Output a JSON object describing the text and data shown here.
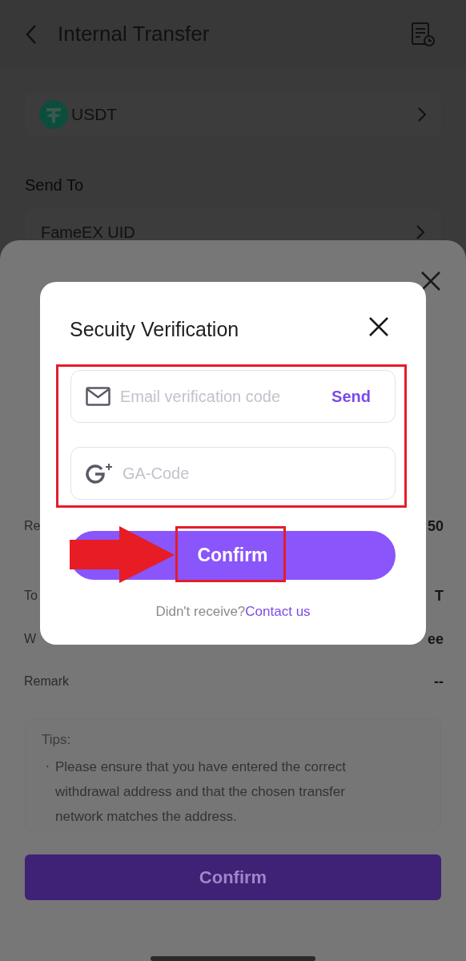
{
  "header": {
    "title": "Internal Transfer"
  },
  "coin": {
    "symbol": "USDT"
  },
  "send_to": {
    "label": "Send To",
    "value": "FameEX UID"
  },
  "sheet": {
    "rows": [
      {
        "label": "Re",
        "value": "50"
      },
      {
        "label": "To",
        "value": "T"
      },
      {
        "label": "W",
        "value": "ee"
      },
      {
        "label": "Remark",
        "value": "--"
      }
    ],
    "tips": {
      "title": "Tips:",
      "items": [
        {
          "bullet": "・",
          "text": "Please ensure that you have entered the correct withdrawal address and that the chosen transfer network matches the address."
        }
      ]
    },
    "button": "Confirm"
  },
  "dialog": {
    "title": "Secuity Verification",
    "fields": [
      {
        "kind": "email",
        "placeholder": "Email verification code",
        "action": "Send"
      },
      {
        "kind": "ga",
        "placeholder": "GA-Code"
      }
    ],
    "button": "Confirm",
    "footer": {
      "text": "Didn't receive?",
      "link": "Contact us"
    }
  }
}
